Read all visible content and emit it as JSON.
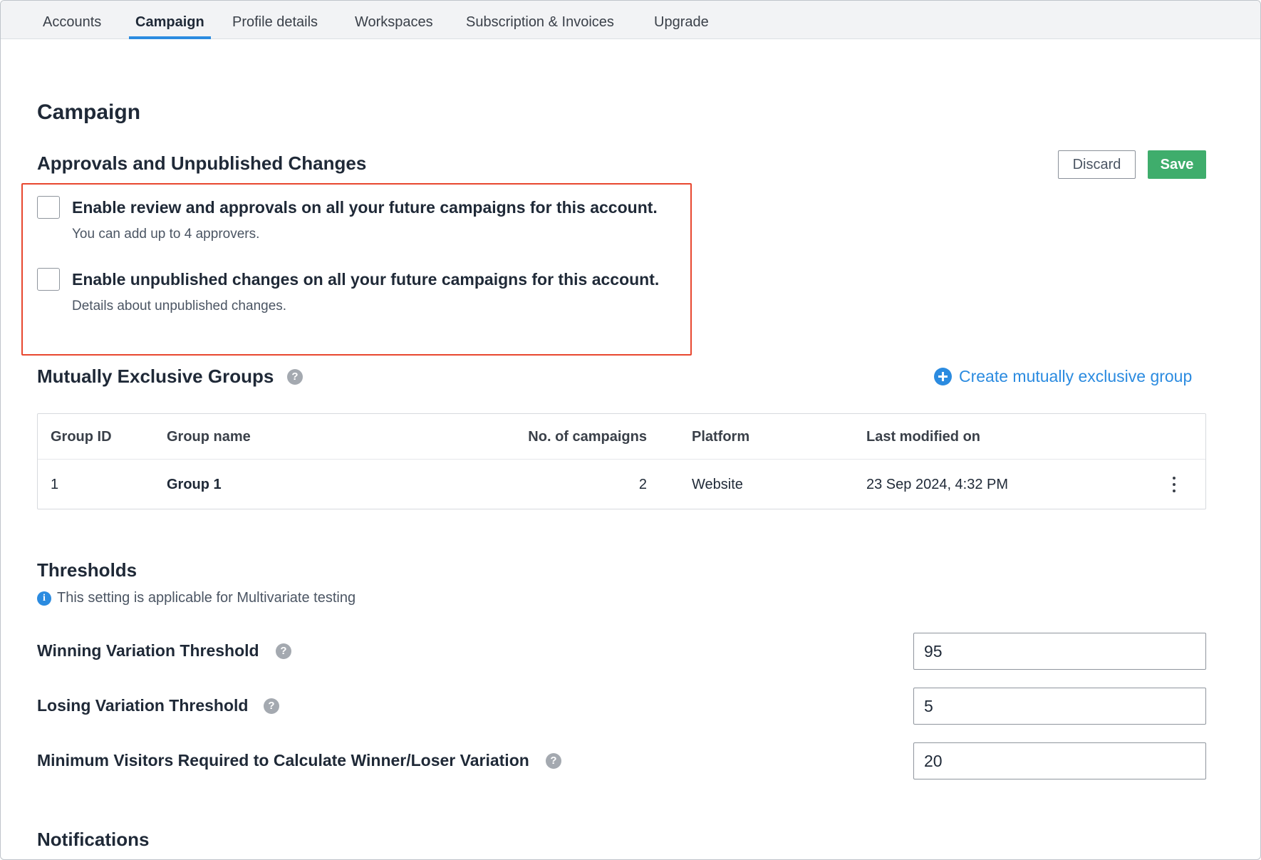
{
  "tabs": [
    {
      "label": "Accounts"
    },
    {
      "label": "Campaign"
    },
    {
      "label": "Profile details"
    },
    {
      "label": "Workspaces"
    },
    {
      "label": "Subscription & Invoices"
    },
    {
      "label": "Upgrade"
    }
  ],
  "active_tab": "Campaign",
  "page_title": "Campaign",
  "approvals": {
    "heading": "Approvals and Unpublished Changes",
    "discard_label": "Discard",
    "save_label": "Save",
    "options": [
      {
        "title": "Enable review and approvals on all your future campaigns for this account.",
        "description": "You can add up to 4 approvers.",
        "checked": false
      },
      {
        "title": "Enable unpublished changes on all your future campaigns for this account.",
        "description": "Details about unpublished changes.",
        "checked": false
      }
    ]
  },
  "groups": {
    "heading": "Mutually Exclusive Groups",
    "create_label": "Create mutually exclusive group",
    "columns": [
      "Group ID",
      "Group name",
      "No. of campaigns",
      "Platform",
      "Last modified on"
    ],
    "rows": [
      {
        "id": "1",
        "name": "Group 1",
        "campaigns": "2",
        "platform": "Website",
        "modified": "23 Sep 2024, 4:32 PM"
      }
    ]
  },
  "thresholds": {
    "heading": "Thresholds",
    "info": "This setting is applicable for Multivariate testing",
    "fields": [
      {
        "label": "Winning Variation Threshold",
        "value": "95"
      },
      {
        "label": "Losing Variation Threshold",
        "value": "5"
      },
      {
        "label": "Minimum Visitors Required to Calculate Winner/Loser Variation",
        "value": "20"
      }
    ]
  },
  "notifications": {
    "heading": "Notifications"
  },
  "colors": {
    "accent": "#2b8be0",
    "save": "#3fad6c",
    "highlight": "#e8472f"
  },
  "icons": {
    "help": "help-icon",
    "info": "info-icon",
    "add": "plus-circle-icon",
    "menu": "kebab-menu-icon"
  }
}
